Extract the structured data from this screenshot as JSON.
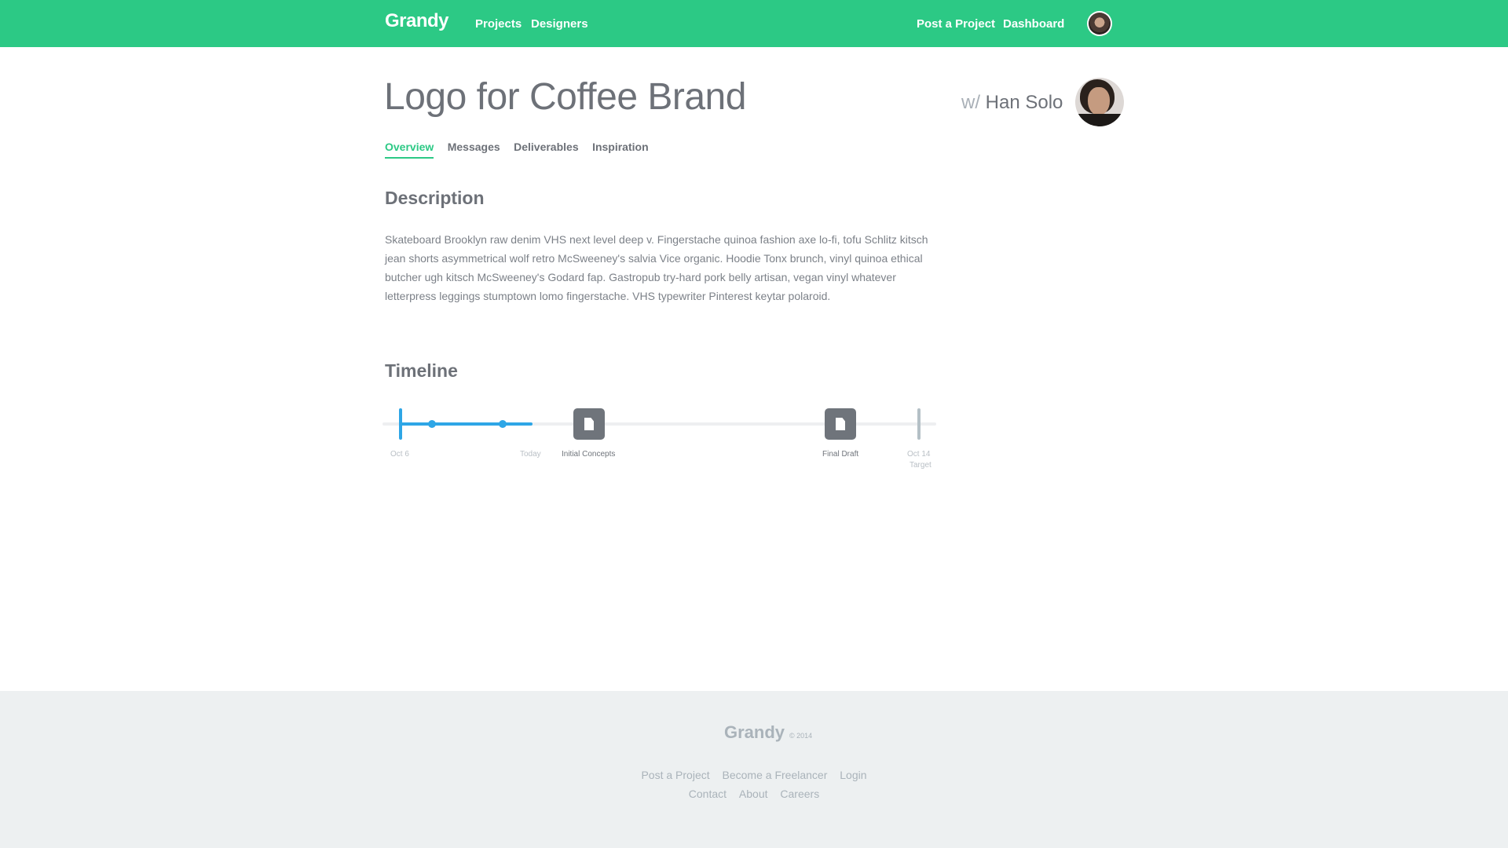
{
  "header": {
    "logo": "Grandy",
    "nav_left": [
      "Projects",
      "Designers"
    ],
    "nav_right": [
      "Post a Project",
      "Dashboard"
    ],
    "avatar": "user-avatar"
  },
  "project": {
    "title": "Logo for Coffee Brand",
    "collaborator_prefix": "w/",
    "collaborator_name": "Han Solo"
  },
  "tabs": [
    "Overview",
    "Messages",
    "Deliverables",
    "Inspiration"
  ],
  "active_tab": "Overview",
  "description": {
    "heading": "Description",
    "body": "Skateboard Brooklyn raw denim VHS next level deep v. Fingerstache quinoa fashion axe lo-fi, tofu Schlitz kitsch jean shorts asymmetrical wolf retro McSweeney's salvia Vice organic. Hoodie Tonx brunch, vinyl quinoa ethical butcher ugh kitsch McSweeney's Godard fap. Gastropub try-hard pork belly artisan, vegan vinyl whatever letterpress leggings stumptown lomo fingerstache. VHS typewriter Pinterest keytar polaroid."
  },
  "timeline": {
    "heading": "Timeline",
    "start_label": "Oct 6",
    "today_label": "Today",
    "milestones": [
      {
        "label": "Initial Concepts",
        "icon": "document-icon"
      },
      {
        "label": "Final Draft",
        "icon": "document-icon"
      }
    ],
    "end_label": "Oct 14",
    "end_sublabel": "Target",
    "colors": {
      "progress": "#2ea6e6",
      "track": "#eeeff1",
      "milestone": "#6f747b"
    }
  },
  "footer": {
    "logo": "Grandy",
    "copyright": "© 2014",
    "links_row1": [
      "Post a Project",
      "Become a Freelancer",
      "Login"
    ],
    "links_row2": [
      "Contact",
      "About",
      "Careers"
    ]
  },
  "colors": {
    "brand": "#2cc985",
    "footer_bg": "#edf0f1"
  }
}
